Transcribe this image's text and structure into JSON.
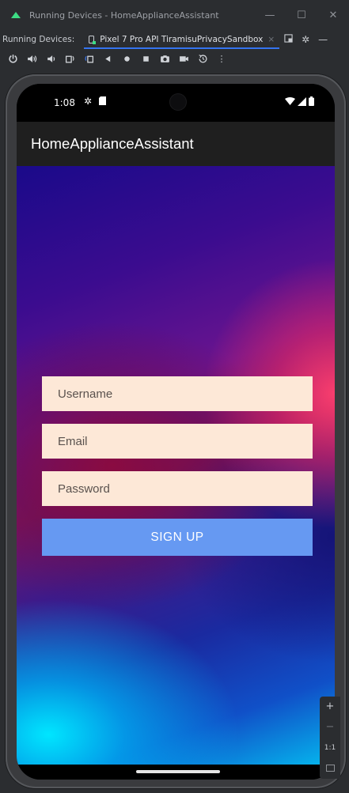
{
  "window": {
    "title": "Running Devices - HomeApplianceAssistant",
    "minimize": "—",
    "maximize": "☐",
    "close": "✕"
  },
  "tabs": {
    "label": "Running Devices:",
    "device_tab": "Pixel 7 Pro API TiramisuPrivacySandbox",
    "close": "×"
  },
  "toolbar_icons": [
    "power-icon",
    "volume-up-icon",
    "volume-down-icon",
    "rotate-left-icon",
    "rotate-right-icon",
    "back-icon",
    "home-icon",
    "overview-icon",
    "screenshot-icon",
    "screen-record-icon",
    "snapshot-icon",
    "more-icon"
  ],
  "status_bar": {
    "time": "1:08"
  },
  "app_bar": {
    "title": "HomeApplianceAssistant"
  },
  "form": {
    "username_placeholder": "Username",
    "email_placeholder": "Email",
    "password_placeholder": "Password",
    "signup_label": "SIGN UP"
  },
  "zoom": {
    "zoom_in": "+",
    "zoom_out": "−",
    "ratio": "1:1"
  },
  "colors": {
    "field_bg": "#fde8d7",
    "button_bg": "#6699f2",
    "app_bar_bg": "#1f1f1f",
    "accent": "#3574f0"
  }
}
